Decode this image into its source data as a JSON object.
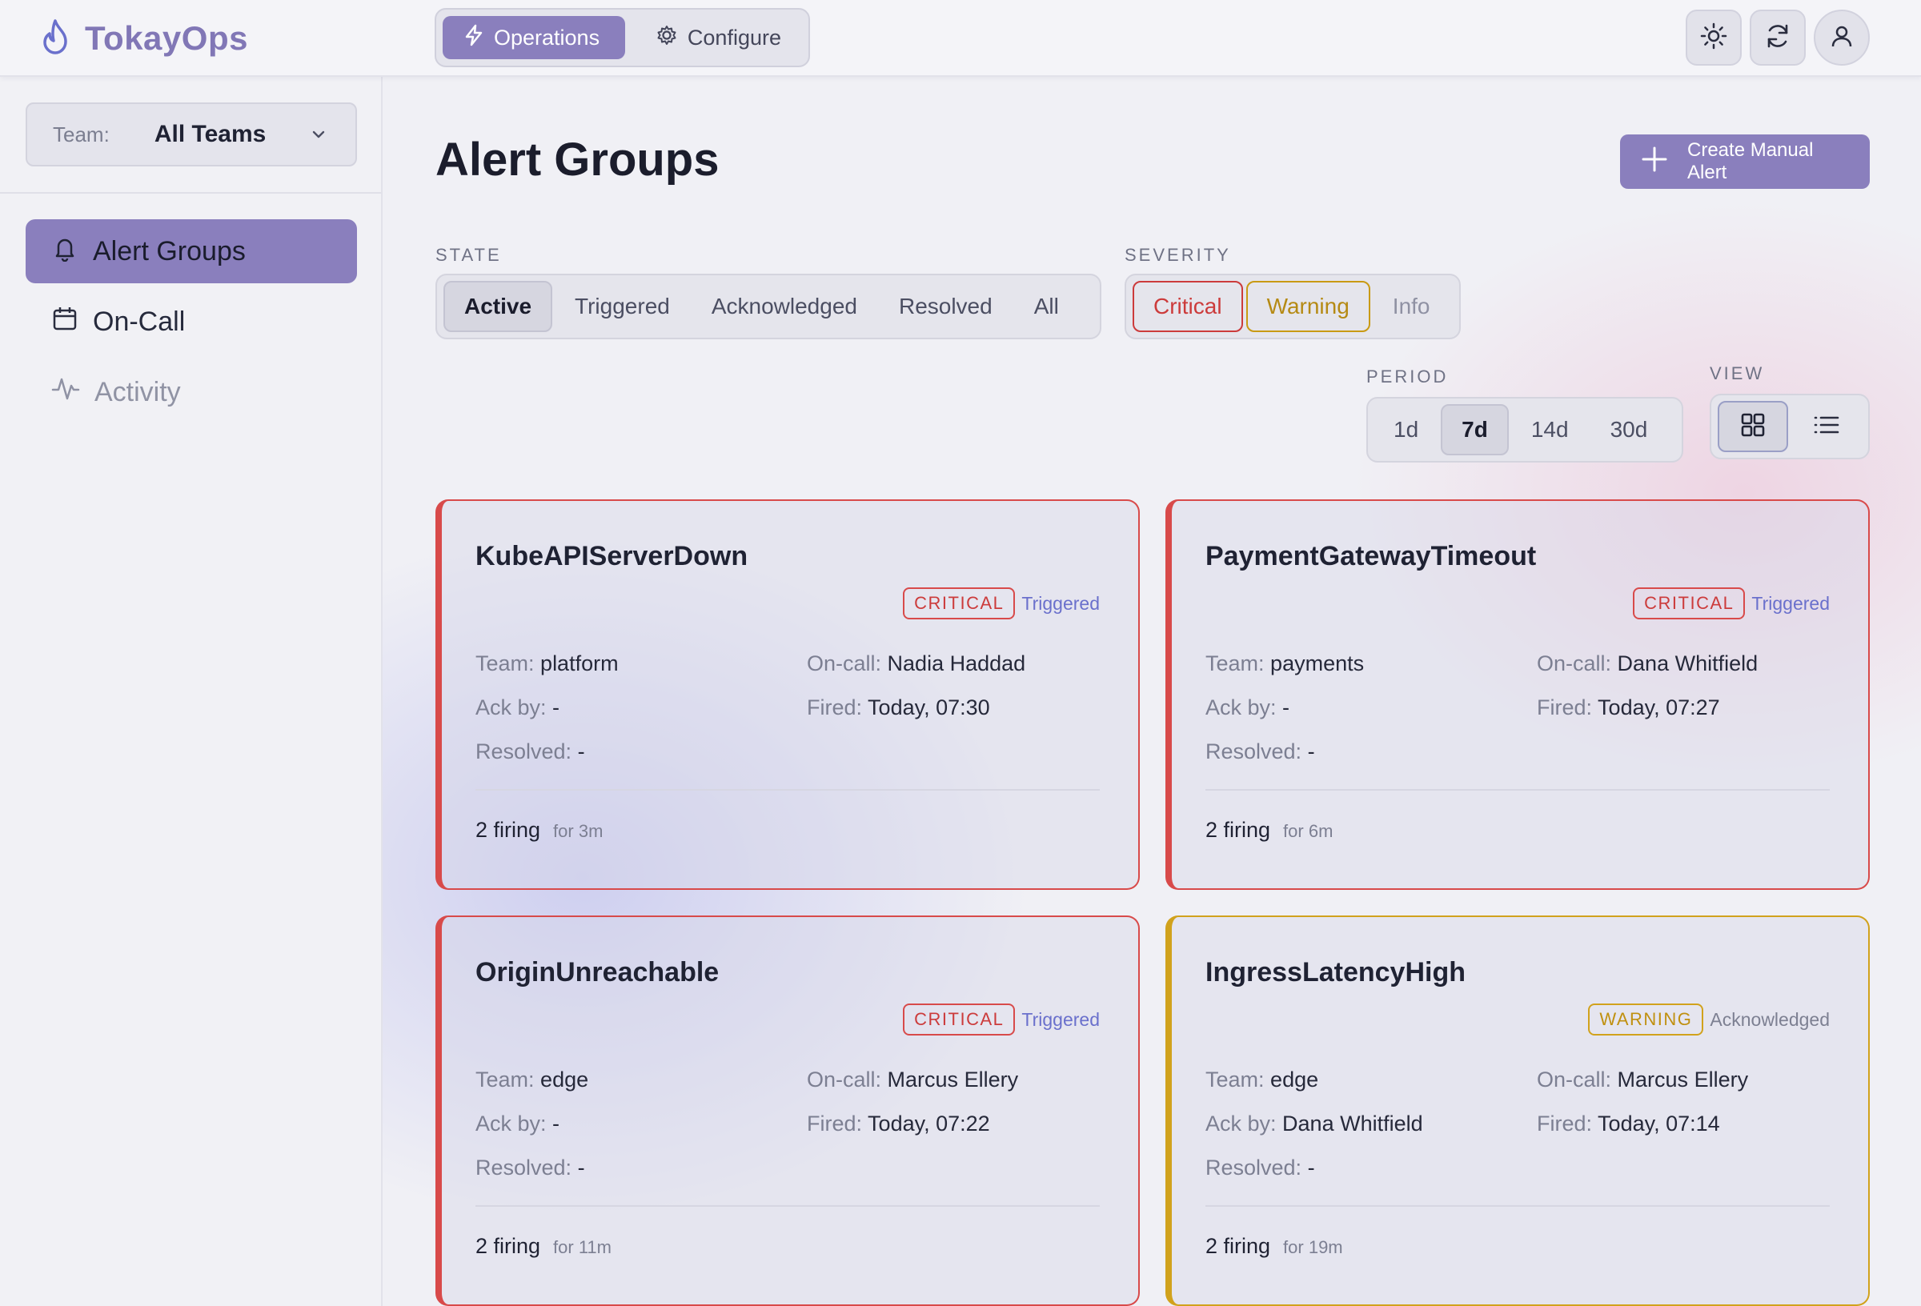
{
  "app": {
    "name": "TokayOps"
  },
  "modes": [
    {
      "label": "Operations",
      "icon": "bolt-icon",
      "active": true
    },
    {
      "label": "Configure",
      "icon": "gear-icon",
      "active": false
    }
  ],
  "top_actions": [
    "sun-icon",
    "refresh-icon",
    "user-icon"
  ],
  "sidebar": {
    "team_label": "Team:",
    "team_value": "All Teams",
    "items": [
      {
        "label": "Alert Groups",
        "icon": "bell-icon",
        "active": true
      },
      {
        "label": "On-Call",
        "icon": "calendar-icon",
        "active": false
      },
      {
        "label": "Activity",
        "icon": "activity-icon",
        "active": false
      }
    ]
  },
  "main": {
    "title": "Alert Groups",
    "create_button": "Create Manual Alert",
    "state_filter": {
      "label": "STATE",
      "options": [
        "Active",
        "Triggered",
        "Acknowledged",
        "Resolved",
        "All"
      ],
      "selected": "Active"
    },
    "severity_filter": {
      "label": "SEVERITY",
      "options": [
        "Critical",
        "Warning",
        "Info"
      ],
      "selected": [
        "Critical",
        "Warning"
      ]
    },
    "period_filter": {
      "label": "PERIOD",
      "options": [
        "1d",
        "7d",
        "14d",
        "30d"
      ],
      "selected": "7d"
    },
    "view_toggle": {
      "label": "VIEW",
      "options": [
        "grid-icon",
        "list-icon"
      ],
      "selected": "grid-icon"
    },
    "labels": {
      "team": "Team:",
      "oncall": "On-call:",
      "ack": "Ack by:",
      "fired": "Fired:",
      "resolved": "Resolved:"
    },
    "cards": [
      {
        "title": "KubeAPIServerDown",
        "severity": "CRITICAL",
        "state": "Triggered",
        "team": "platform",
        "oncall": "Nadia Haddad",
        "ack_by": "-",
        "fired": "Today, 07:30",
        "resolved": "-",
        "firing": "2 firing",
        "duration": "for 3m"
      },
      {
        "title": "PaymentGatewayTimeout",
        "severity": "CRITICAL",
        "state": "Triggered",
        "team": "payments",
        "oncall": "Dana Whitfield",
        "ack_by": "-",
        "fired": "Today, 07:27",
        "resolved": "-",
        "firing": "2 firing",
        "duration": "for 6m"
      },
      {
        "title": "OriginUnreachable",
        "severity": "CRITICAL",
        "state": "Triggered",
        "team": "edge",
        "oncall": "Marcus Ellery",
        "ack_by": "-",
        "fired": "Today, 07:22",
        "resolved": "-",
        "firing": "2 firing",
        "duration": "for 11m"
      },
      {
        "title": "IngressLatencyHigh",
        "severity": "WARNING",
        "state": "Acknowledged",
        "team": "edge",
        "oncall": "Marcus Ellery",
        "ack_by": "Dana Whitfield",
        "fired": "Today, 07:14",
        "resolved": "-",
        "firing": "2 firing",
        "duration": "for 19m"
      }
    ]
  },
  "colors": {
    "accent": "#8a7fbd",
    "critical": "#cc3b3b",
    "warning": "#c99a13",
    "triggered": "#6a70cc"
  }
}
